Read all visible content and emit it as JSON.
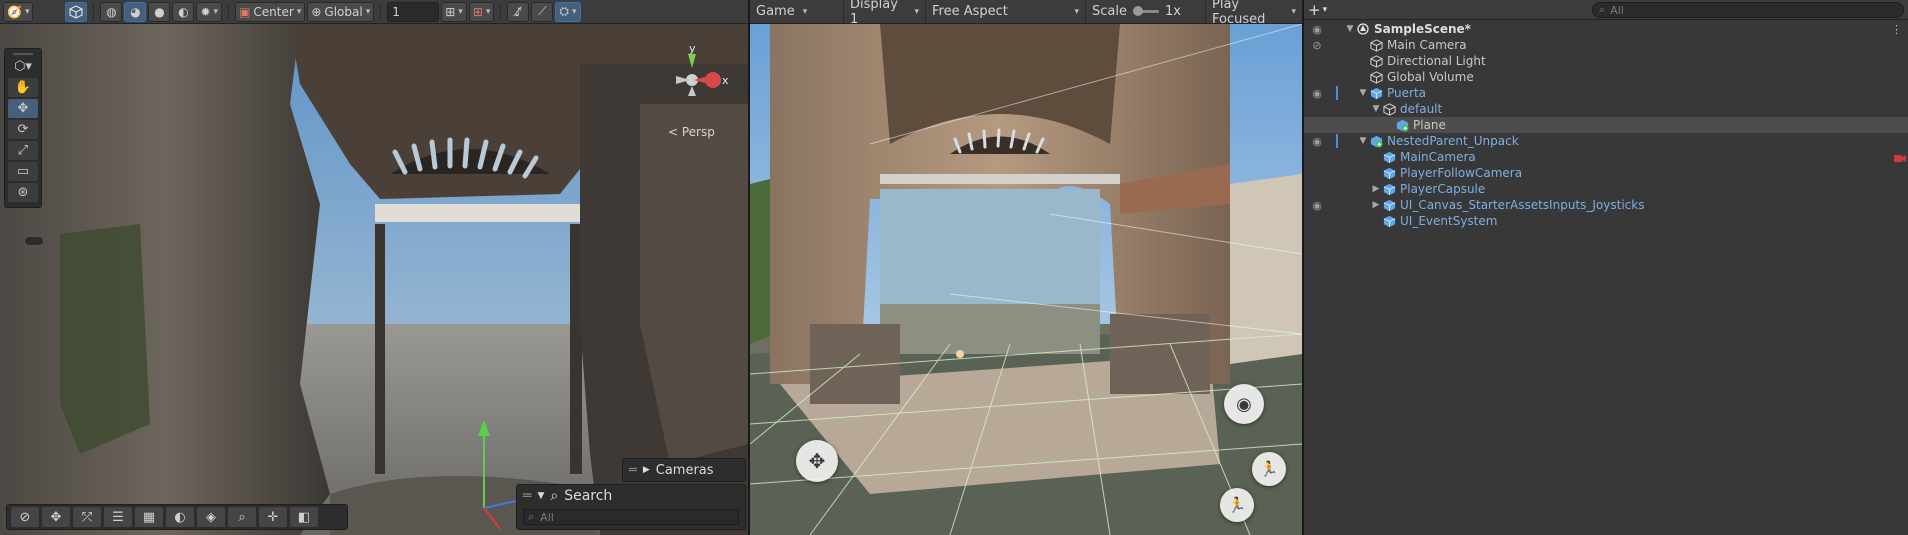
{
  "scene_view": {
    "toolbar": {
      "center_pivot": "Center",
      "global_local": "Global",
      "grid_snap_value": "1"
    },
    "persp_label": "< Persp",
    "gizmo_axis_y": "y",
    "gizmo_axis_x": "x",
    "cameras_overlay": "Cameras",
    "search_overlay": {
      "title": "Search",
      "placeholder": "All"
    }
  },
  "game_view": {
    "toolbar": {
      "mode": "Game",
      "display": "Display 1",
      "aspect": "Free Aspect",
      "scale_label": "Scale",
      "scale_value": "1x",
      "scale_fraction": 0.0,
      "play_focused": "Play Focused"
    }
  },
  "hierarchy": {
    "search_placeholder": "All",
    "rows": [
      {
        "label": "SampleScene*",
        "depth": 0,
        "kind": "scene",
        "foldout": "open",
        "icon": "unity-scene-icon",
        "eye": "visible"
      },
      {
        "label": "Main Camera",
        "depth": 1,
        "kind": "object",
        "foldout": "none",
        "icon": "gameobject-cube-icon",
        "eye": "hidden"
      },
      {
        "label": "Directional Light",
        "depth": 1,
        "kind": "object",
        "foldout": "none",
        "icon": "gameobject-cube-icon",
        "eye": "none"
      },
      {
        "label": "Global Volume",
        "depth": 1,
        "kind": "object",
        "foldout": "none",
        "icon": "gameobject-cube-icon",
        "eye": "none"
      },
      {
        "label": "Puerta",
        "depth": 1,
        "kind": "prefab",
        "foldout": "open",
        "icon": "prefab-cube-icon",
        "eye": "visible",
        "mark": true
      },
      {
        "label": "default",
        "depth": 2,
        "kind": "prefab",
        "foldout": "open",
        "icon": "gameobject-cube-icon",
        "eye": "none"
      },
      {
        "label": "Plane",
        "depth": 3,
        "kind": "object",
        "foldout": "none",
        "icon": "prefab-added-icon",
        "eye": "none",
        "selected": true
      },
      {
        "label": "NestedParent_Unpack",
        "depth": 1,
        "kind": "prefab",
        "foldout": "open",
        "icon": "prefab-added-icon",
        "eye": "visible",
        "mark": true
      },
      {
        "label": "MainCamera",
        "depth": 2,
        "kind": "prefab",
        "foldout": "none",
        "icon": "prefab-cube-icon",
        "eye": "none",
        "extra": "camera-gizmo-icon"
      },
      {
        "label": "PlayerFollowCamera",
        "depth": 2,
        "kind": "prefab",
        "foldout": "none",
        "icon": "prefab-cube-icon",
        "eye": "none"
      },
      {
        "label": "PlayerCapsule",
        "depth": 2,
        "kind": "prefab",
        "foldout": "closed",
        "icon": "prefab-cube-icon",
        "eye": "none"
      },
      {
        "label": "UI_Canvas_StarterAssetsInputs_Joysticks",
        "depth": 2,
        "kind": "prefab",
        "foldout": "closed",
        "icon": "prefab-cube-icon",
        "eye": "visible"
      },
      {
        "label": "UI_EventSystem",
        "depth": 2,
        "kind": "prefab",
        "foldout": "none",
        "icon": "prefab-cube-icon",
        "eye": "none"
      }
    ]
  },
  "colors": {
    "prefab_text": "#7bafe4",
    "selection_accent": "#3a74b0",
    "panel_bg": "#383838"
  }
}
